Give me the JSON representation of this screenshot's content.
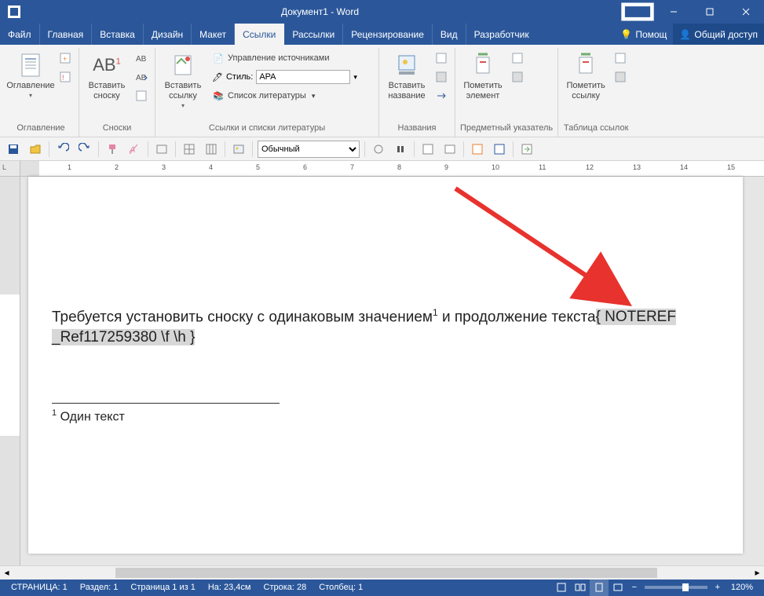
{
  "title": "Документ1 - Word",
  "menu": {
    "file": "Файл",
    "tabs": [
      "Главная",
      "Вставка",
      "Дизайн",
      "Макет",
      "Ссылки",
      "Рассылки",
      "Рецензирование",
      "Вид",
      "Разработчик"
    ],
    "activeIndex": 4,
    "help": "Помощ",
    "share": "Общий доступ"
  },
  "ribbon": {
    "g1": {
      "label": "Оглавление",
      "btn": "Оглавление"
    },
    "g2": {
      "label": "Сноски",
      "btn": "Вставить сноску",
      "ab": "AB"
    },
    "g3": {
      "label": "Ссылки и списки литературы",
      "btn": "Вставить ссылку",
      "manage": "Управление источниками",
      "style_lbl": "Стиль:",
      "style_val": "APA",
      "biblio": "Список литературы"
    },
    "g4": {
      "label": "Названия",
      "btn": "Вставить название"
    },
    "g5": {
      "label": "Предметный указатель",
      "btn": "Пометить элемент"
    },
    "g6": {
      "label": "Таблица ссылок",
      "btn": "Пометить ссылку"
    }
  },
  "qat": {
    "style": "Обычный"
  },
  "document": {
    "text_before": "Требуется установить сноску с одинаковым значением",
    "sup1": "1",
    "text_mid": " и продолжение текста",
    "field": "{ NOTEREF _Ref117259380 \\f \\h }",
    "fn_num": "1",
    "fn_text": " Один текст"
  },
  "status": {
    "page": "СТРАНИЦА: 1",
    "section": "Раздел: 1",
    "pageof": "Страница 1 из 1",
    "at": "На: 23,4см",
    "line": "Строка: 28",
    "col": "Столбец: 1",
    "zoom": "120%"
  }
}
